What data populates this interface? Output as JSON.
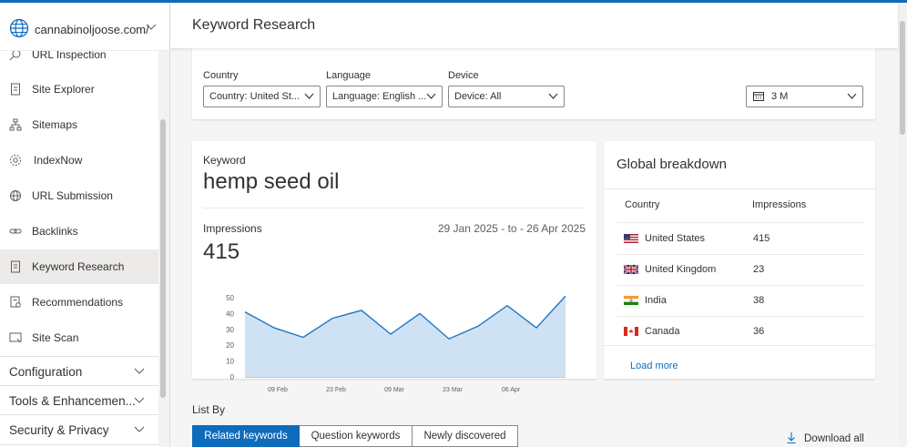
{
  "site": {
    "name": "cannabinoljoose.com/"
  },
  "header": {
    "title": "Keyword Research"
  },
  "nav": {
    "items": [
      {
        "label": "URL Inspection"
      },
      {
        "label": "Site Explorer"
      },
      {
        "label": "Sitemaps"
      },
      {
        "label": "IndexNow"
      },
      {
        "label": "URL Submission"
      },
      {
        "label": "Backlinks"
      },
      {
        "label": "Keyword Research"
      },
      {
        "label": "Recommendations"
      },
      {
        "label": "Site Scan"
      }
    ],
    "groups": [
      {
        "label": "Configuration"
      },
      {
        "label": "Tools & Enhancemen..."
      },
      {
        "label": "Security & Privacy"
      }
    ]
  },
  "filters": {
    "country_label": "Country",
    "country_value": "Country: United St...",
    "language_label": "Language",
    "language_value": "Language: English ...",
    "device_label": "Device",
    "device_value": "Device: All",
    "range_value": "3 M"
  },
  "keyword": {
    "label": "Keyword",
    "value": "hemp seed oil",
    "impressions_label": "Impressions",
    "impressions_value": "415",
    "date_range": "29 Jan 2025 - to - 26 Apr 2025"
  },
  "chart_data": {
    "type": "area",
    "x_ticks": [
      "09 Feb",
      "23 Feb",
      "09 Mar",
      "23 Mar",
      "06 Apr"
    ],
    "y_ticks": [
      "50",
      "40",
      "30",
      "20",
      "10",
      "0"
    ],
    "ylim": [
      0,
      50
    ],
    "values": [
      41,
      31,
      25,
      37,
      42,
      27,
      40,
      24,
      32,
      45,
      31,
      51
    ],
    "color": "#1f77c4",
    "fill": "#cfe2f3"
  },
  "global": {
    "title": "Global breakdown",
    "col_country": "Country",
    "col_impressions": "Impressions",
    "rows": [
      {
        "country": "United States",
        "impressions": "415",
        "flag": "us-flag"
      },
      {
        "country": "United Kingdom",
        "impressions": "23",
        "flag": "uk-flag"
      },
      {
        "country": "India",
        "impressions": "38",
        "flag": "india-flag"
      },
      {
        "country": "Canada",
        "impressions": "36",
        "flag": "canada-flag"
      }
    ],
    "load_more": "Load more"
  },
  "list": {
    "label": "List By",
    "tabs": [
      "Related keywords",
      "Question keywords",
      "Newly discovered"
    ],
    "download": "Download all"
  }
}
